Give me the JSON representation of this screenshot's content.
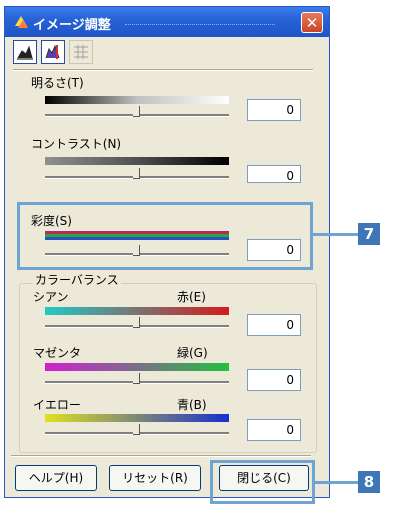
{
  "window": {
    "title": "イメージ調整",
    "close_glyph": "✕"
  },
  "toolbar": {
    "buttons": [
      {
        "icon": "histogram-icon",
        "state": "active"
      },
      {
        "icon": "color-histogram-icon",
        "state": "active"
      },
      {
        "icon": "grid-icon",
        "state": "disabled"
      }
    ]
  },
  "brightness": {
    "label": "明るさ(T)",
    "value": "0"
  },
  "contrast": {
    "label": "コントラスト(N)",
    "value": "0"
  },
  "saturation": {
    "label": "彩度(S)",
    "value": "0"
  },
  "color_balance": {
    "title": "カラーバランス",
    "rows": [
      {
        "left": "シアン",
        "right": "赤(E)",
        "value": "0",
        "colors": [
          "#22c8c8",
          "#d41c1c"
        ]
      },
      {
        "left": "マゼンタ",
        "right": "緑(G)",
        "value": "0",
        "colors": [
          "#d020d0",
          "#22c040"
        ]
      },
      {
        "left": "イエロー",
        "right": "青(B)",
        "value": "0",
        "colors": [
          "#e0e020",
          "#1830d0"
        ]
      }
    ]
  },
  "footer": {
    "help_label": "ヘルプ(H)",
    "reset_label": "リセット(R)",
    "close_label": "閉じる(C)"
  },
  "callouts": {
    "saturation": "7",
    "close": "8"
  },
  "accent": "#6fa3d1"
}
